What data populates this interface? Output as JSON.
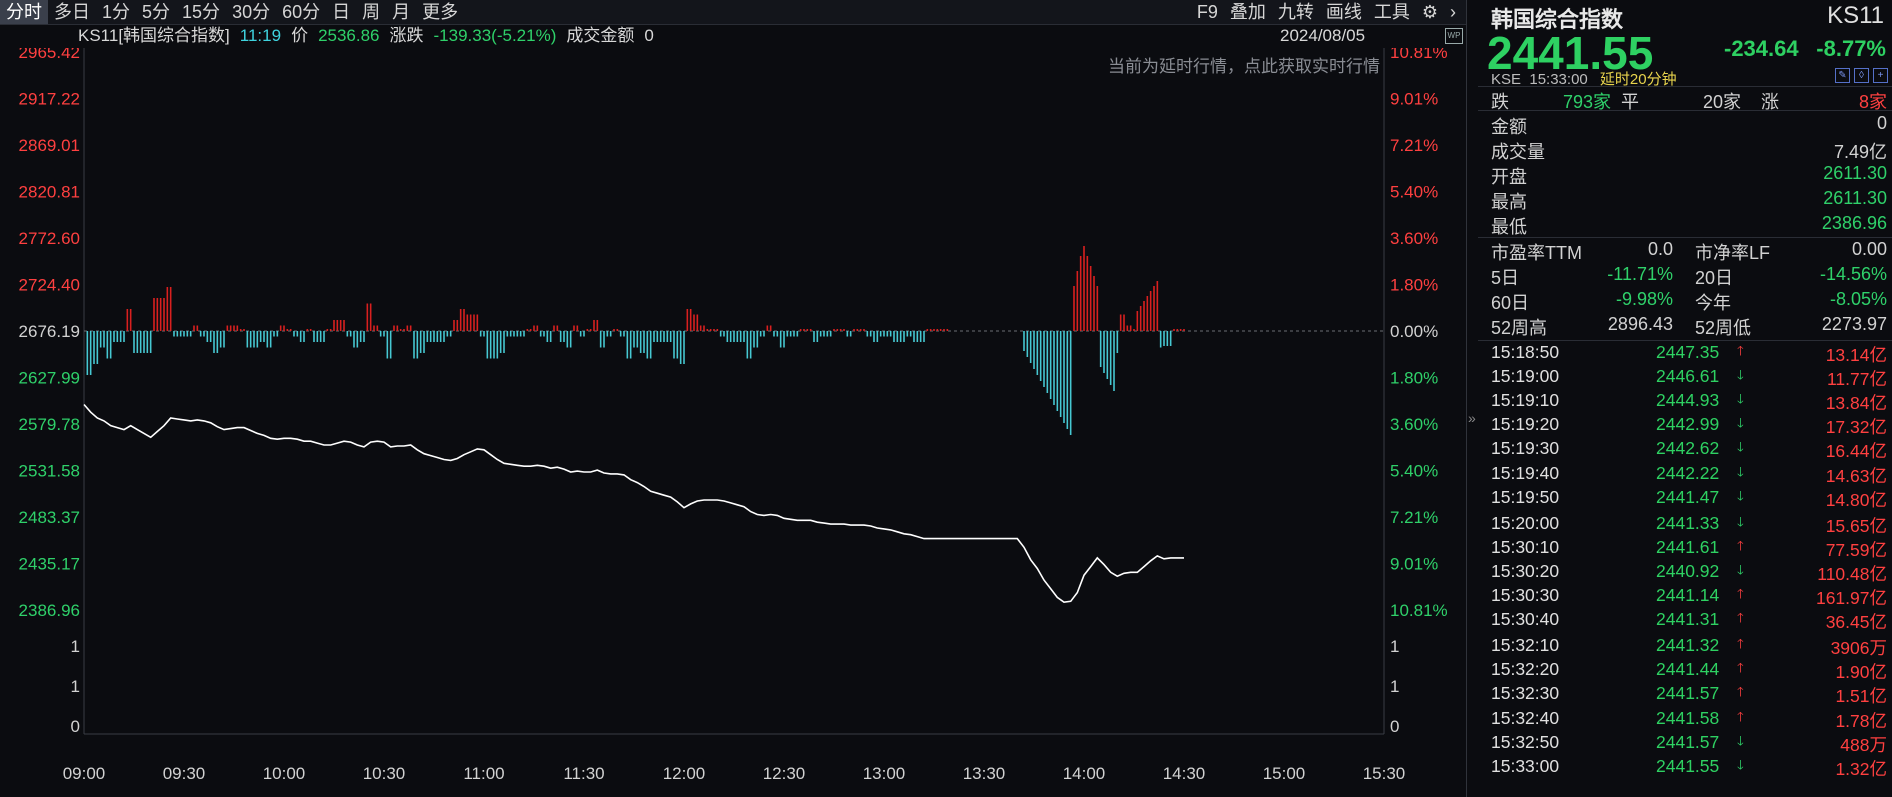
{
  "toolbar": {
    "periods": [
      "分时",
      "多日",
      "1分",
      "5分",
      "15分",
      "30分",
      "60分",
      "日",
      "周",
      "月",
      "更多"
    ],
    "active_period": "分时",
    "right_items": [
      "F9",
      "叠加",
      "九转",
      "画线",
      "工具"
    ],
    "settings_icon": "gear-icon",
    "next_icon": "chevron-right-icon"
  },
  "infobar": {
    "code_name": "KS11[韩国综合指数]",
    "time": "11:19",
    "price_label": "价",
    "price": "2536.86",
    "change_label": "涨跌",
    "change": "-139.33(-5.21%)",
    "amount_label": "成交金额",
    "amount": "0",
    "date": "2024/08/05",
    "watermark_icon": "WP"
  },
  "delay_note": "当前为延时行情，点此获取实时行情",
  "colors": {
    "up": "#ff4040",
    "down": "#2fd16a",
    "bar_down": "#46c8d2",
    "bar_up": "#d9201f",
    "line": "#ffffff",
    "grid": "#2a2d35"
  },
  "chart_data": {
    "type": "line",
    "prev_close": 2676.19,
    "price_axis_left": [
      "2965.42",
      "2917.22",
      "2869.01",
      "2820.81",
      "2772.60",
      "2724.40",
      "2676.19",
      "2627.99",
      "2579.78",
      "2531.58",
      "2483.37",
      "2435.17",
      "2386.96"
    ],
    "price_axis_right": [
      "10.81%",
      "9.01%",
      "7.21%",
      "5.40%",
      "3.60%",
      "1.80%",
      "0.00%",
      "1.80%",
      "3.60%",
      "5.40%",
      "7.21%",
      "9.01%",
      "10.81%"
    ],
    "volume_axis_left": [
      "1",
      "1",
      "0"
    ],
    "volume_axis_right": [
      "1",
      "1",
      "0"
    ],
    "x_ticks": [
      "09:00",
      "09:30",
      "10:00",
      "10:30",
      "11:00",
      "11:30",
      "12:00",
      "12:30",
      "13:00",
      "13:30",
      "14:00",
      "14:30",
      "15:00",
      "15:30"
    ],
    "ylim": [
      2386.96,
      2965.42
    ],
    "price_series": [
      [
        0,
        2600
      ],
      [
        2,
        2592
      ],
      [
        4,
        2586
      ],
      [
        6,
        2583
      ],
      [
        8,
        2578
      ],
      [
        10,
        2576
      ],
      [
        12,
        2574
      ],
      [
        14,
        2578
      ],
      [
        16,
        2574
      ],
      [
        18,
        2570
      ],
      [
        20,
        2566
      ],
      [
        22,
        2572
      ],
      [
        24,
        2578
      ],
      [
        26,
        2586
      ],
      [
        28,
        2585
      ],
      [
        30,
        2584
      ],
      [
        32,
        2583
      ],
      [
        34,
        2584
      ],
      [
        36,
        2583
      ],
      [
        38,
        2581
      ],
      [
        40,
        2577
      ],
      [
        42,
        2574
      ],
      [
        44,
        2575
      ],
      [
        46,
        2576
      ],
      [
        48,
        2576
      ],
      [
        50,
        2573
      ],
      [
        52,
        2570
      ],
      [
        54,
        2568
      ],
      [
        56,
        2565
      ],
      [
        58,
        2564
      ],
      [
        60,
        2565
      ],
      [
        62,
        2565
      ],
      [
        64,
        2564
      ],
      [
        66,
        2562
      ],
      [
        68,
        2562
      ],
      [
        70,
        2560
      ],
      [
        72,
        2558
      ],
      [
        74,
        2558
      ],
      [
        76,
        2560
      ],
      [
        78,
        2562
      ],
      [
        80,
        2561
      ],
      [
        82,
        2558
      ],
      [
        84,
        2556
      ],
      [
        86,
        2561
      ],
      [
        88,
        2562
      ],
      [
        90,
        2561
      ],
      [
        92,
        2556
      ],
      [
        94,
        2557
      ],
      [
        96,
        2557
      ],
      [
        98,
        2558
      ],
      [
        100,
        2553
      ],
      [
        102,
        2549
      ],
      [
        104,
        2547
      ],
      [
        106,
        2545
      ],
      [
        108,
        2543
      ],
      [
        110,
        2542
      ],
      [
        112,
        2544
      ],
      [
        114,
        2548
      ],
      [
        116,
        2551
      ],
      [
        118,
        2554
      ],
      [
        120,
        2553
      ],
      [
        122,
        2548
      ],
      [
        124,
        2543
      ],
      [
        126,
        2539
      ],
      [
        128,
        2538
      ],
      [
        130,
        2537
      ],
      [
        132,
        2536
      ],
      [
        134,
        2536
      ],
      [
        136,
        2537
      ],
      [
        138,
        2536
      ],
      [
        140,
        2534
      ],
      [
        142,
        2535
      ],
      [
        144,
        2533
      ],
      [
        146,
        2530
      ],
      [
        148,
        2531
      ],
      [
        150,
        2530
      ],
      [
        152,
        2530
      ],
      [
        154,
        2532
      ],
      [
        156,
        2529
      ],
      [
        158,
        2528
      ],
      [
        160,
        2528
      ],
      [
        162,
        2527
      ],
      [
        164,
        2522
      ],
      [
        166,
        2519
      ],
      [
        168,
        2515
      ],
      [
        170,
        2510
      ],
      [
        172,
        2508
      ],
      [
        174,
        2506
      ],
      [
        176,
        2504
      ],
      [
        178,
        2499
      ],
      [
        180,
        2493
      ],
      [
        182,
        2497
      ],
      [
        184,
        2500
      ],
      [
        186,
        2501
      ],
      [
        188,
        2501
      ],
      [
        190,
        2501
      ],
      [
        192,
        2500
      ],
      [
        194,
        2498
      ],
      [
        196,
        2496
      ],
      [
        198,
        2494
      ],
      [
        200,
        2489
      ],
      [
        202,
        2486
      ],
      [
        204,
        2485
      ],
      [
        206,
        2486
      ],
      [
        208,
        2485
      ],
      [
        210,
        2482
      ],
      [
        212,
        2481
      ],
      [
        214,
        2480
      ],
      [
        216,
        2480
      ],
      [
        218,
        2480
      ],
      [
        220,
        2478
      ],
      [
        222,
        2477
      ],
      [
        224,
        2476
      ],
      [
        226,
        2476
      ],
      [
        228,
        2476
      ],
      [
        230,
        2475
      ],
      [
        232,
        2475
      ],
      [
        234,
        2475
      ],
      [
        236,
        2474
      ],
      [
        238,
        2472
      ],
      [
        240,
        2471
      ],
      [
        242,
        2470
      ],
      [
        244,
        2468
      ],
      [
        246,
        2466
      ],
      [
        248,
        2465
      ],
      [
        250,
        2463
      ],
      [
        252,
        2461
      ],
      [
        254,
        2461
      ],
      [
        256,
        2461
      ],
      [
        258,
        2461
      ],
      [
        260,
        2461
      ],
      [
        262,
        2461
      ],
      [
        264,
        2461
      ],
      [
        266,
        2461
      ],
      [
        268,
        2461
      ],
      [
        270,
        2461
      ],
      [
        272,
        2461
      ],
      [
        274,
        2461
      ],
      [
        276,
        2461
      ],
      [
        278,
        2461
      ],
      [
        280,
        2461
      ],
      [
        282,
        2452
      ],
      [
        284,
        2439
      ],
      [
        286,
        2430
      ],
      [
        288,
        2418
      ],
      [
        290,
        2409
      ],
      [
        292,
        2400
      ],
      [
        294,
        2395
      ],
      [
        296,
        2396
      ],
      [
        298,
        2405
      ],
      [
        300,
        2423
      ],
      [
        302,
        2432
      ],
      [
        304,
        2441
      ],
      [
        306,
        2434
      ],
      [
        308,
        2426
      ],
      [
        310,
        2422
      ],
      [
        312,
        2425
      ],
      [
        314,
        2426
      ],
      [
        316,
        2426
      ],
      [
        318,
        2432
      ],
      [
        320,
        2438
      ],
      [
        322,
        2443
      ],
      [
        324,
        2440
      ],
      [
        326,
        2441
      ],
      [
        328,
        2441
      ],
      [
        330,
        2441
      ]
    ]
  },
  "panel": {
    "title": "韩国综合指数",
    "code": "KS11",
    "price": "2441.55",
    "change": "-234.64",
    "change_pct": "-8.77%",
    "exchange": "KSE",
    "time": "15:33:00",
    "delay": "延时20分钟",
    "advdec": {
      "down_label": "跌",
      "down": "793家",
      "flat_label": "平",
      "flat": "20家",
      "up_label": "涨",
      "up": "8家"
    },
    "stats": [
      {
        "k": "金额",
        "v": "0",
        "color": "#d2d2d2"
      },
      {
        "k": "成交量",
        "v": "7.49亿",
        "color": "#d2d2d2"
      },
      {
        "k": "开盘",
        "v": "2611.30",
        "color": "#2fd16a"
      },
      {
        "k": "最高",
        "v": "2611.30",
        "color": "#2fd16a"
      },
      {
        "k": "最低",
        "v": "2386.96",
        "color": "#2fd16a"
      }
    ],
    "ratios": [
      {
        "k1": "市盈率TTM",
        "v1": "0.0",
        "c1": "#d2d2d2",
        "k2": "市净率LF",
        "v2": "0.00",
        "c2": "#d2d2d2"
      },
      {
        "k1": "5日",
        "v1": "-11.71%",
        "c1": "#2fd16a",
        "k2": "20日",
        "v2": "-14.56%",
        "c2": "#2fd16a"
      },
      {
        "k1": "60日",
        "v1": "-9.98%",
        "c1": "#2fd16a",
        "k2": "今年",
        "v2": "-8.05%",
        "c2": "#2fd16a"
      },
      {
        "k1": "52周高",
        "v1": "2896.43",
        "c1": "#d2d2d2",
        "k2": "52周低",
        "v2": "2273.97",
        "c2": "#d2d2d2"
      }
    ],
    "ticks": [
      {
        "t": "15:18:50",
        "p": "2447.35",
        "dir": "up",
        "vol": "13.14亿"
      },
      {
        "t": "15:19:00",
        "p": "2446.61",
        "dir": "down",
        "vol": "11.77亿"
      },
      {
        "t": "15:19:10",
        "p": "2444.93",
        "dir": "down",
        "vol": "13.84亿"
      },
      {
        "t": "15:19:20",
        "p": "2442.99",
        "dir": "down",
        "vol": "17.32亿"
      },
      {
        "t": "15:19:30",
        "p": "2442.62",
        "dir": "down",
        "vol": "16.44亿"
      },
      {
        "t": "15:19:40",
        "p": "2442.22",
        "dir": "down",
        "vol": "14.63亿"
      },
      {
        "t": "15:19:50",
        "p": "2441.47",
        "dir": "down",
        "vol": "14.80亿"
      },
      {
        "t": "15:20:00",
        "p": "2441.33",
        "dir": "down",
        "vol": "15.65亿"
      },
      {
        "t": "15:30:10",
        "p": "2441.61",
        "dir": "up",
        "vol": "77.59亿"
      },
      {
        "t": "15:30:20",
        "p": "2440.92",
        "dir": "down",
        "vol": "110.48亿"
      },
      {
        "t": "15:30:30",
        "p": "2441.14",
        "dir": "up",
        "vol": "161.97亿"
      },
      {
        "t": "15:30:40",
        "p": "2441.31",
        "dir": "up",
        "vol": "36.45亿"
      },
      {
        "t": "15:32:10",
        "p": "2441.32",
        "dir": "up",
        "vol": "3906万"
      },
      {
        "t": "15:32:20",
        "p": "2441.44",
        "dir": "up",
        "vol": "1.90亿"
      },
      {
        "t": "15:32:30",
        "p": "2441.57",
        "dir": "up",
        "vol": "1.51亿"
      },
      {
        "t": "15:32:40",
        "p": "2441.58",
        "dir": "up",
        "vol": "1.78亿"
      },
      {
        "t": "15:32:50",
        "p": "2441.57",
        "dir": "down",
        "vol": "488万"
      },
      {
        "t": "15:33:00",
        "p": "2441.55",
        "dir": "down",
        "vol": "1.32亿"
      }
    ]
  }
}
